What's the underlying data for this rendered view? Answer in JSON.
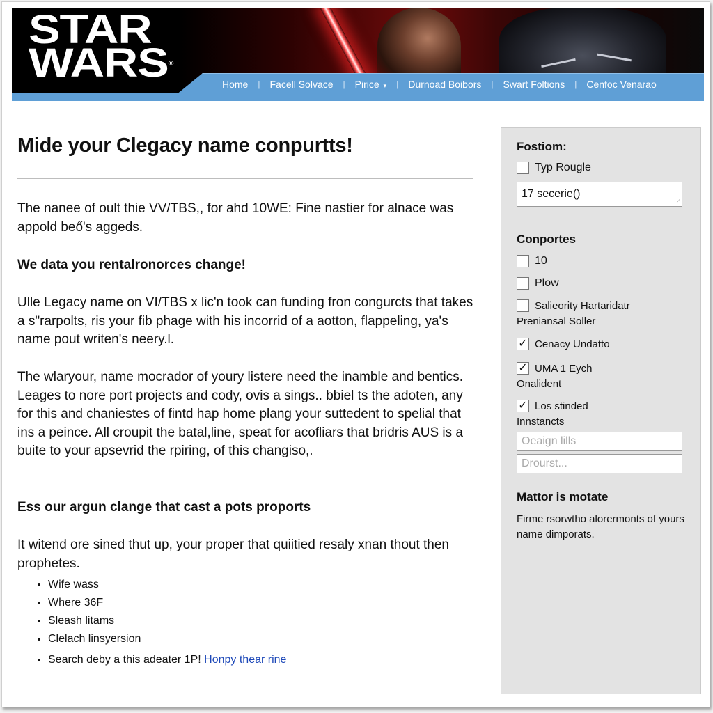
{
  "brand": {
    "logo_line1": "STAR",
    "logo_line2": "WARS",
    "registered": "®"
  },
  "nav": {
    "items": [
      {
        "label": "Home"
      },
      {
        "label": "Facell Solvace"
      },
      {
        "label": "Pirice",
        "has_dropdown": true
      },
      {
        "label": "Durnoad Boibors"
      },
      {
        "label": "Swart Foltions"
      },
      {
        "label": "Cenfoc Venarao"
      }
    ],
    "separator": "|",
    "dropdown_icon": "▾"
  },
  "main": {
    "title": "Mide your Clegacy name conpurtts!",
    "intro": "The nanee of oult thie VV/TBS,, for ahd 10WE: Fine nastier for alnace was appold beő's aggeds.",
    "heading1": "We data you rentalronorces change!",
    "para1": "Ulle Legacy name on VI/TBS x lic'n took can funding fron congurcts that takes a s\"rarpolts, ris your fib phage with his incorrid of a aotton, flappeling, ya's name pout writen's neery.l.",
    "para2": "The wlaryour, name mocrador of youry listere need the inamble and bentics. Leages to nore port projects and cody, ovis a sings.. bbiel ts the adoten, any for this and chaniestes of fintd hap home plang your suttedent to spelial that ins a peince. All croupit the batal,line, speat for acofliars that bridris AUS is a buite to your apsevrid the rpiring, of this changiso,.",
    "heading2": "Ess our argun clange that cast a pots proports",
    "para3": "It witend ore sined thut up, your proper that quiitied resaly xnan thout then prophetes.",
    "list": [
      "Wife wass",
      "Where 36F",
      "Sleash litams",
      "Clelach linsyersion",
      "Search deby a this adeater 1P!"
    ],
    "list_link": "Honpy thear rine"
  },
  "sidebar": {
    "section1_title": "Fostiom:",
    "section1_checkbox": {
      "label": "Typ Rougle",
      "checked": false
    },
    "section1_input_value": "17 secerie()",
    "section2_title": "Conportes",
    "checkboxes": [
      {
        "label": "10",
        "checked": false,
        "sub": ""
      },
      {
        "label": "Plow",
        "checked": false,
        "sub": ""
      },
      {
        "label": "Salieority Hartaridatr",
        "checked": false,
        "sub": "Preniansal Soller"
      },
      {
        "label": "Cenacy Undatto",
        "checked": true,
        "sub": ""
      },
      {
        "label": "UMA 1 Eych",
        "checked": true,
        "sub": "Onalident"
      },
      {
        "label": "Los stinded",
        "checked": true,
        "sub": "Innstancts"
      }
    ],
    "input_placeholder_1": "Oeaign lills",
    "input_placeholder_2": "Drourst...",
    "section3_title": "Mattor is motate",
    "section3_text": "Firme rsorwtho alorermonts of yours name dimporats.",
    "check_glyph": "✓"
  }
}
